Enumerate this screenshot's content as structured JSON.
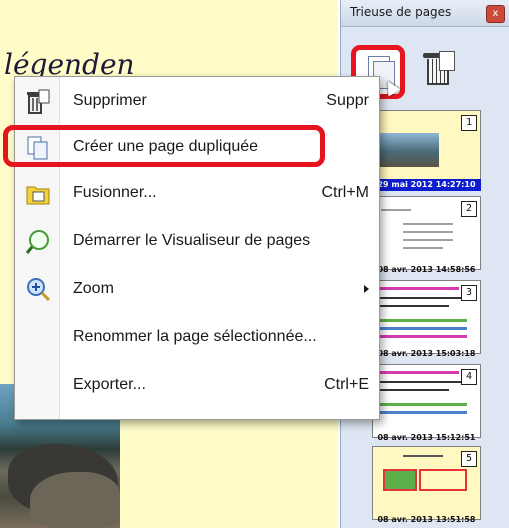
{
  "document": {
    "title_fragment": "légenden"
  },
  "page_sorter": {
    "title": "Trieuse de pages",
    "close_label": "x",
    "thumbnails": [
      {
        "number": "1",
        "date": "29 mai 2012 14:27:10",
        "selected": true
      },
      {
        "number": "2",
        "date": "08 avr. 2013 14:58:56",
        "selected": false
      },
      {
        "number": "3",
        "date": "08 avr. 2013 15:03:18",
        "selected": false
      },
      {
        "number": "4",
        "date": "08 avr. 2013 15:12:51",
        "selected": false
      },
      {
        "number": "5",
        "date": "08 avr. 2013 13:51:58",
        "selected": false
      }
    ]
  },
  "context_menu": {
    "items": [
      {
        "label": "Supprimer",
        "shortcut": "Suppr",
        "icon": "trash-icon"
      },
      {
        "label": "Créer une page dupliquée",
        "shortcut": "",
        "icon": "duplicate-page-icon",
        "highlighted": true
      },
      {
        "label": "Fusionner...",
        "shortcut": "Ctrl+M",
        "icon": "merge-folder-icon"
      },
      {
        "label": "Démarrer le Visualiseur de pages",
        "shortcut": "",
        "icon": "magnifier-icon"
      },
      {
        "label": "Zoom",
        "shortcut": "",
        "icon": "zoom-icon",
        "submenu": true
      },
      {
        "label": "Renommer la page sélectionnée...",
        "shortcut": "",
        "icon": ""
      },
      {
        "label": "Exporter...",
        "shortcut": "Ctrl+E",
        "icon": ""
      }
    ]
  },
  "colors": {
    "highlight_box": "#e6141e",
    "selected_date_bg": "#0c1dcf",
    "document_bg": "#fffcc8"
  }
}
